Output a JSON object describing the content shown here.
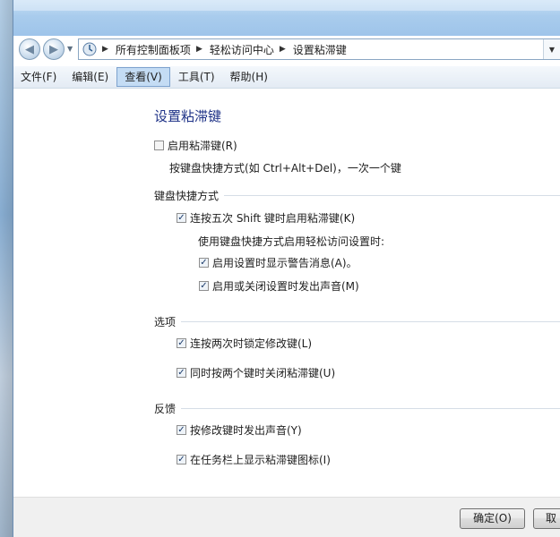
{
  "breadcrumb": {
    "icon": "control-panel-icon",
    "items": [
      "所有控制面板项",
      "轻松访问中心",
      "设置粘滞键"
    ]
  },
  "menubar": {
    "items": [
      "文件(F)",
      "编辑(E)",
      "查看(V)",
      "工具(T)",
      "帮助(H)"
    ],
    "active": "查看(V)"
  },
  "page": {
    "title": "设置粘滞键",
    "enable_sticky": {
      "label": "启用粘滞键(R)",
      "checked": false
    },
    "enable_desc": "按键盘快捷方式(如 Ctrl+Alt+Del)，一次一个键"
  },
  "shortcut": {
    "heading": "键盘快捷方式",
    "shift5": {
      "label": "连按五次 Shift 键时启用粘滞键(K)",
      "checked": true
    },
    "sub_desc": "使用键盘快捷方式启用轻松访问设置时:",
    "warn": {
      "label": "启用设置时显示警告消息(A)。",
      "checked": true
    },
    "sound": {
      "label": "启用或关闭设置时发出声音(M)",
      "checked": true
    }
  },
  "options": {
    "heading": "选项",
    "lock": {
      "label": "连按两次时锁定修改键(L)",
      "checked": true
    },
    "twokeys": {
      "label": "同时按两个键时关闭粘滞键(U)",
      "checked": true
    }
  },
  "feedback": {
    "heading": "反馈",
    "beep": {
      "label": "按修改键时发出声音(Y)",
      "checked": true
    },
    "tray": {
      "label": "在任务栏上显示粘滞键图标(I)",
      "checked": true
    }
  },
  "buttons": {
    "ok": "确定(O)",
    "cancel": "取"
  },
  "colors": {
    "title_blue": "#1e3287",
    "menu_active": "#c4dcf4"
  }
}
